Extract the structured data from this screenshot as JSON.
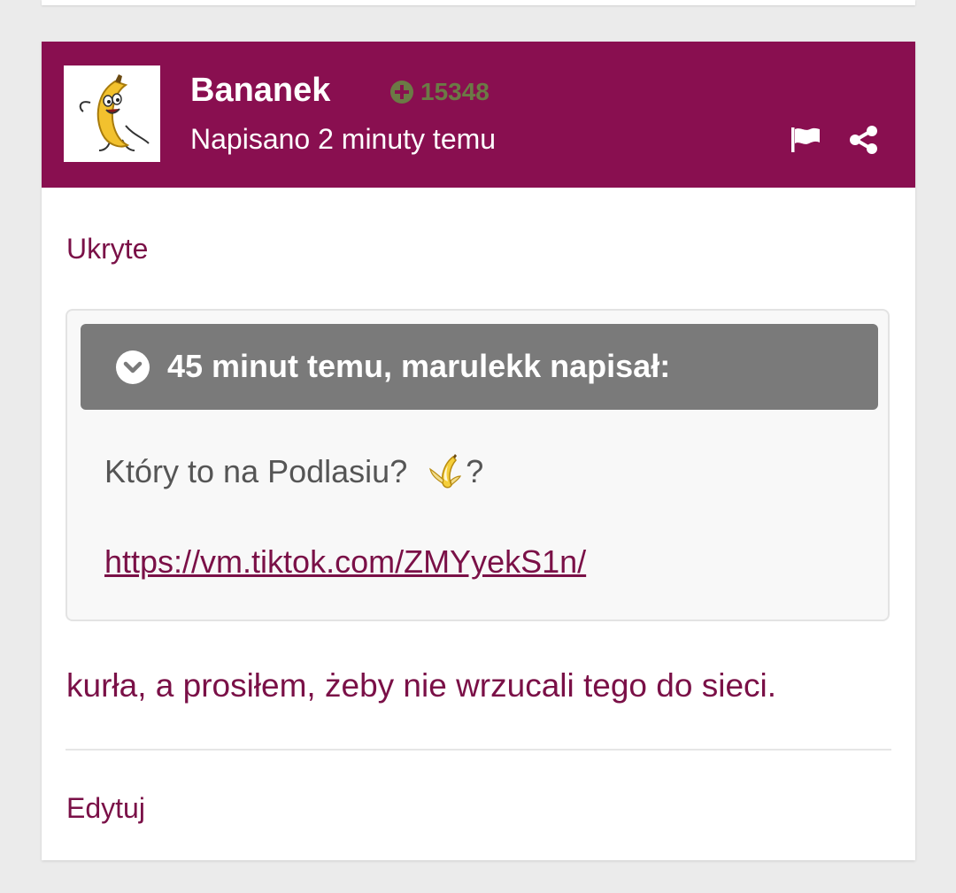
{
  "post": {
    "author": "Bananek",
    "reputation": "15348",
    "posted": "Napisano 2 minuty temu",
    "hidden_label": "Ukryte",
    "quote": {
      "citation": "45 minut temu, marulekk napisał:",
      "text_before": "Który to na Podlasiu?",
      "emoji": "banana-emoji",
      "text_after": "?",
      "link": "https://vm.tiktok.com/ZMYyekS1n/"
    },
    "reply": "kurła, a prosiłem, żeby nie wrzucali tego do sieci.",
    "edit_label": "Edytuj"
  },
  "colors": {
    "header_bg": "#890f50",
    "accent_text": "#7a1047",
    "reputation": "#6b7a45",
    "quote_header": "#7a7a7a",
    "page_bg": "#ebebeb"
  }
}
